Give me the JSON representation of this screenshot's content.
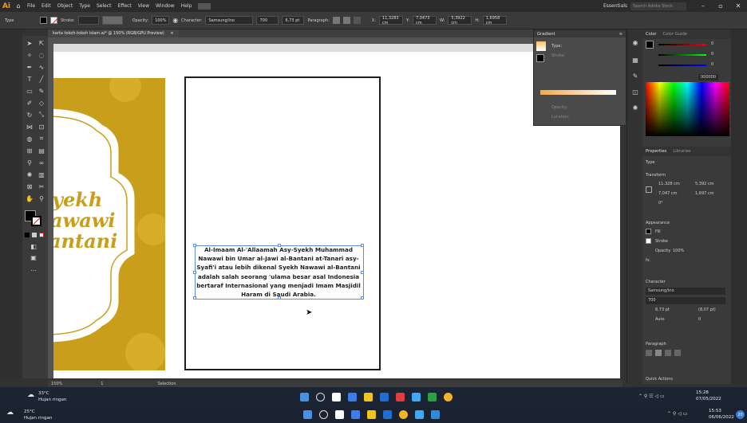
{
  "app": {
    "logo": "Ai",
    "menu": [
      "File",
      "Edit",
      "Object",
      "Type",
      "Select",
      "Effect",
      "View",
      "Window",
      "Help"
    ],
    "workspace": "Essentials",
    "search_placeholder": "Search Adobe Stock"
  },
  "control_bar": {
    "type_label": "Type",
    "stroke_label": "Stroke:",
    "opacity_label": "Opacity:",
    "opacity_value": "100%",
    "character_label": "Character:",
    "font_name": "Samsung/ino",
    "font_style": "700",
    "font_size": "6,73 pt",
    "paragraph_label": "Paragraph:",
    "x_label": "X:",
    "x_value": "11,3283 cm",
    "y_label": "Y:",
    "y_value": "7,0473 cm",
    "w_label": "W:",
    "w_value": "5,3922 cm",
    "h_label": "H:",
    "h_value": "1,6958 cm"
  },
  "document": {
    "tab_title": "karta tokoh-tokoh islam.ai* @ 150% (RGB/GPU Preview)",
    "tab_close": "×",
    "zoom": "150%",
    "artboard_nav": "1",
    "status": "Selection"
  },
  "artwork": {
    "left_text_lines": [
      "yekh",
      "awawi",
      "antani"
    ],
    "body_text": "Al-Imaam Al-'Allaamah Asy-Syekh Muhammad Nawawi bin Umar al-Jawi al-Bantani at-Tanari asy-Syafi'i atau lebih dikenal Syekh Nawawi al-Bantani adalah salah seorang 'ulama besar asal Indonesia bertaraf Internasional yang menjadi Imam Masjidil Haram di Saudi Arabia."
  },
  "gradient_panel": {
    "title": "Gradient",
    "type_label": "Type:",
    "stroke_label": "Stroke:",
    "opacity_label": "Opacity:",
    "location_label": "Location:"
  },
  "color_panel": {
    "tabs": [
      "Color",
      "Color Guide"
    ],
    "hex_value": "000000",
    "r_value": "0",
    "g_value": "0",
    "b_value": "0"
  },
  "properties_panel": {
    "tabs": [
      "Properties",
      "Libraries"
    ],
    "type_heading": "Type",
    "transform_heading": "Transform",
    "x_value": "11,328 cm",
    "w_value": "5,392 cm",
    "y_value": "7,047 cm",
    "h_value": "1,697 cm",
    "angle_value": "0°",
    "appearance_heading": "Appearance",
    "fill_label": "Fill",
    "stroke_label": "Stroke",
    "opacity_label": "Opacity",
    "opacity_value": "100%",
    "fx_label": "fx.",
    "character_heading": "Character",
    "font_name": "Samsung/ino",
    "font_style": "700",
    "font_size": "6,73 pt",
    "leading": "(8,07 pt)",
    "tracking": "Auto",
    "kerning": "0",
    "paragraph_heading": "Paragraph",
    "quick_actions_heading": "Quick Actions"
  },
  "taskbar_top": {
    "weather_temp": "33°C",
    "weather_desc": "Hujan ringan",
    "time": "15:28",
    "date": "07/05/2022"
  },
  "taskbar_bottom": {
    "weather_temp": "25°C",
    "weather_desc": "Hujan ringan",
    "time": "15:53",
    "date": "06/06/2022",
    "notification_count": "20"
  },
  "colors": {
    "gold": "#c89e1a",
    "accent": "#ff9a00"
  }
}
